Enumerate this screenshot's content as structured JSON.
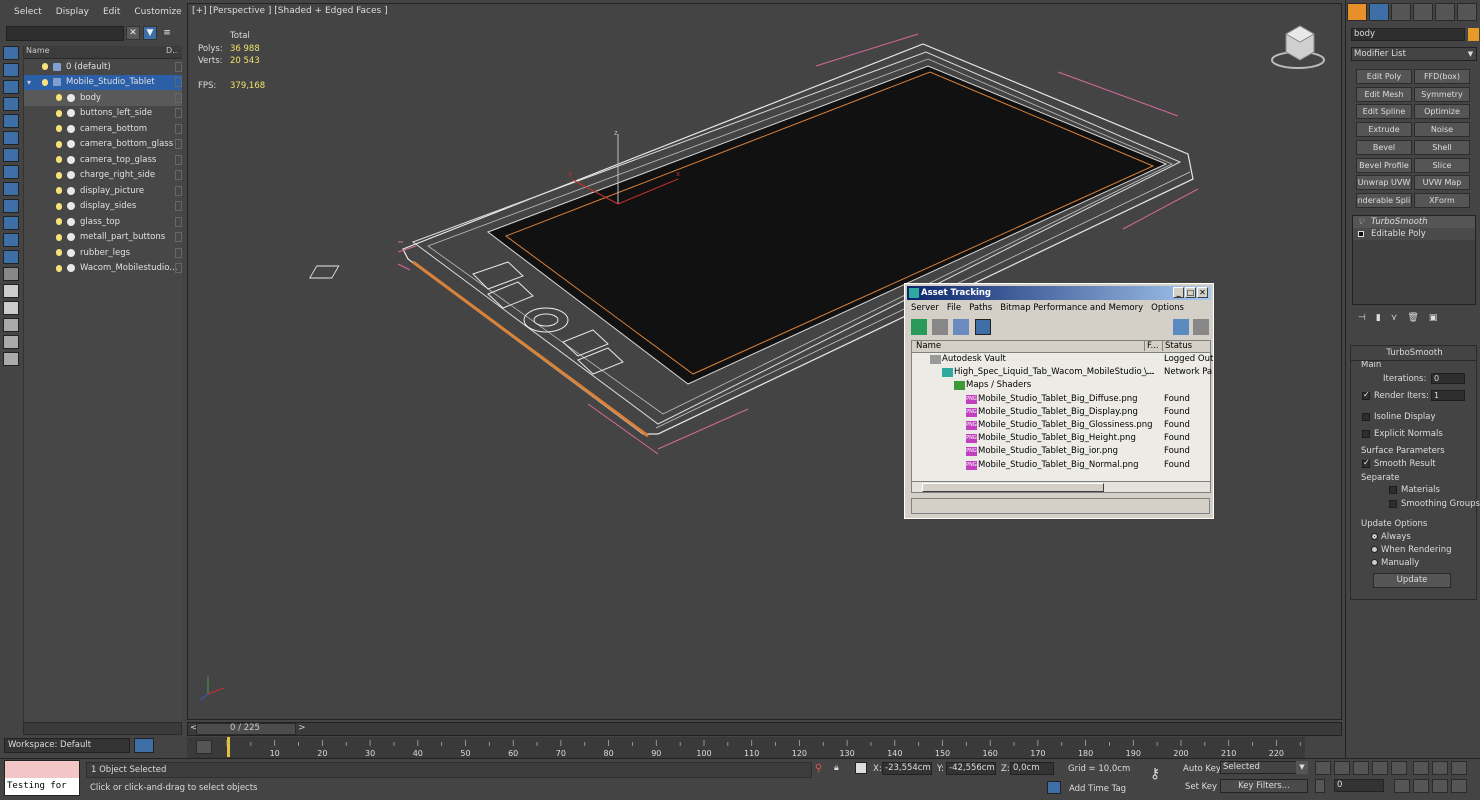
{
  "menu": [
    "Select",
    "Display",
    "Edit",
    "Customize"
  ],
  "explorer": {
    "col_name": "Name",
    "col_d": "D..",
    "items": [
      {
        "label": "0 (default)",
        "level": 1,
        "type": "layer"
      },
      {
        "label": "Mobile_Studio_Tablet",
        "level": 1,
        "type": "layer",
        "selected": true
      },
      {
        "label": "body",
        "level": 2,
        "type": "object",
        "highlighted": true
      },
      {
        "label": "buttons_left_side",
        "level": 2,
        "type": "object"
      },
      {
        "label": "camera_bottom",
        "level": 2,
        "type": "object"
      },
      {
        "label": "camera_bottom_glass",
        "level": 2,
        "type": "object"
      },
      {
        "label": "camera_top_glass",
        "level": 2,
        "type": "object"
      },
      {
        "label": "charge_right_side",
        "level": 2,
        "type": "object"
      },
      {
        "label": "display_picture",
        "level": 2,
        "type": "object"
      },
      {
        "label": "display_sides",
        "level": 2,
        "type": "object"
      },
      {
        "label": "glass_top",
        "level": 2,
        "type": "object"
      },
      {
        "label": "metall_part_buttons",
        "level": 2,
        "type": "object"
      },
      {
        "label": "rubber_legs",
        "level": 2,
        "type": "object"
      },
      {
        "label": "Wacom_Mobilestudio...",
        "level": 2,
        "type": "group"
      }
    ],
    "workspace": "Workspace: Default"
  },
  "viewport": {
    "label": "[+] [Perspective ] [Shaded + Edged Faces ]",
    "stats_header": "Total",
    "polys_label": "Polys:",
    "polys": "36 988",
    "verts_label": "Verts:",
    "verts": "20 543",
    "fps_label": "FPS:",
    "fps": "379,168",
    "axis_x": "x",
    "axis_y": "y",
    "axis_z": "z"
  },
  "time_slider": {
    "text": "0 / 225",
    "current": 0,
    "total": 225
  },
  "timeline": {
    "ticks": [
      "10",
      "20",
      "30",
      "40",
      "50",
      "60",
      "70",
      "80",
      "90",
      "100",
      "110",
      "120",
      "130",
      "140",
      "150",
      "160",
      "170",
      "180",
      "190",
      "200",
      "210",
      "220"
    ]
  },
  "status": {
    "selection": "1 Object Selected",
    "prompt": "Click or click-and-drag to select objects",
    "x_label": "X:",
    "x_val": "-23,554cm",
    "y_label": "Y:",
    "y_val": "-42,556cm",
    "z_label": "Z:",
    "z_val": "0,0cm",
    "grid": "Grid = 10,0cm",
    "add_time_tag": "Add Time Tag",
    "auto_key": "Auto Key",
    "set_key": "Set Key",
    "selected_dropdown": "Selected",
    "key_filters": "Key Filters...",
    "frame": "0",
    "maxscript": "Testing for"
  },
  "command_panel": {
    "object_name": "body",
    "object_color": "#e79a28",
    "modifier_list": "Modifier List",
    "modifier_buttons": [
      "Edit Poly",
      "FFD(box)",
      "Edit Mesh",
      "Symmetry",
      "Edit Spline",
      "Optimize",
      "Extrude",
      "Noise",
      "Bevel",
      "Shell",
      "Bevel Profile",
      "Slice",
      "Unwrap UVW",
      "UVW Map",
      "enderable Splin",
      "XForm"
    ],
    "stack": [
      "TurboSmooth",
      "Editable Poly"
    ],
    "turbosmooth": {
      "title": "TurboSmooth",
      "main": "Main",
      "iterations_label": "Iterations:",
      "iterations": "0",
      "render_iters_label": "Render Iters:",
      "render_iters": "1",
      "isoline": "Isoline Display",
      "explicit_normals": "Explicit Normals",
      "surface_params": "Surface Parameters",
      "smooth_result": "Smooth Result",
      "separate": "Separate",
      "materials": "Materials",
      "smoothing_groups": "Smoothing Groups",
      "update_options": "Update Options",
      "always": "Always",
      "when_rendering": "When Rendering",
      "manually": "Manually",
      "update": "Update"
    }
  },
  "asset_tracking": {
    "title": "Asset Tracking",
    "menu": [
      "Server",
      "File",
      "Paths",
      "Bitmap Performance and Memory",
      "Options"
    ],
    "col_name": "Name",
    "col_f": "F...",
    "col_status": "Status",
    "rows": [
      {
        "name": "Autodesk Vault",
        "indent": 18,
        "f": "",
        "status": "Logged Out"
      },
      {
        "name": "High_Spec_Liquid_Tab_Wacom_MobileStudio_...",
        "indent": 30,
        "f": "\\...",
        "status": "Network Pa"
      },
      {
        "name": "Maps / Shaders",
        "indent": 42,
        "f": "",
        "status": ""
      },
      {
        "name": "Mobile_Studio_Tablet_Big_Diffuse.png",
        "indent": 54,
        "f": "",
        "status": "Found"
      },
      {
        "name": "Mobile_Studio_Tablet_Big_Display.png",
        "indent": 54,
        "f": "",
        "status": "Found"
      },
      {
        "name": "Mobile_Studio_Tablet_Big_Glossiness.png",
        "indent": 54,
        "f": "",
        "status": "Found"
      },
      {
        "name": "Mobile_Studio_Tablet_Big_Height.png",
        "indent": 54,
        "f": "",
        "status": "Found"
      },
      {
        "name": "Mobile_Studio_Tablet_Big_ior.png",
        "indent": 54,
        "f": "",
        "status": "Found"
      },
      {
        "name": "Mobile_Studio_Tablet_Big_Normal.png",
        "indent": 54,
        "f": "",
        "status": "Found"
      }
    ]
  }
}
